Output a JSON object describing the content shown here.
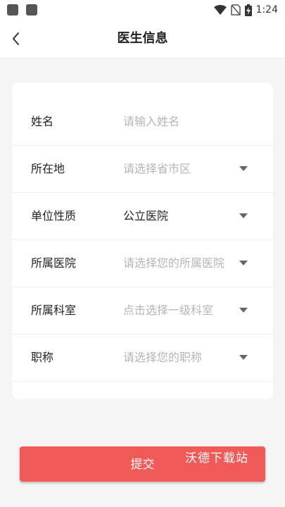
{
  "status_bar": {
    "time": "1:24",
    "icons": [
      "notification-square-icon",
      "notification-square-icon",
      "wifi-icon",
      "no-sim-icon",
      "battery-charging-icon"
    ]
  },
  "header": {
    "title": "医生信息",
    "back_icon": "chevron-left-icon"
  },
  "form": {
    "rows": [
      {
        "label": "姓名",
        "value": "",
        "placeholder": "请输入姓名",
        "type": "input"
      },
      {
        "label": "所在地",
        "value": "",
        "placeholder": "请选择省市区",
        "type": "select"
      },
      {
        "label": "单位性质",
        "value": "公立医院",
        "placeholder": "",
        "type": "select"
      },
      {
        "label": "所属医院",
        "value": "",
        "placeholder": "请选择您的所属医院",
        "type": "select"
      },
      {
        "label": "所属科室",
        "value": "",
        "placeholder": "点击选择一级科室",
        "type": "select"
      },
      {
        "label": "职称",
        "value": "",
        "placeholder": "请选择您的职称",
        "type": "select"
      }
    ]
  },
  "submit": {
    "label": "提交",
    "color": "#f25a57"
  },
  "watermark": "沃德下载站"
}
